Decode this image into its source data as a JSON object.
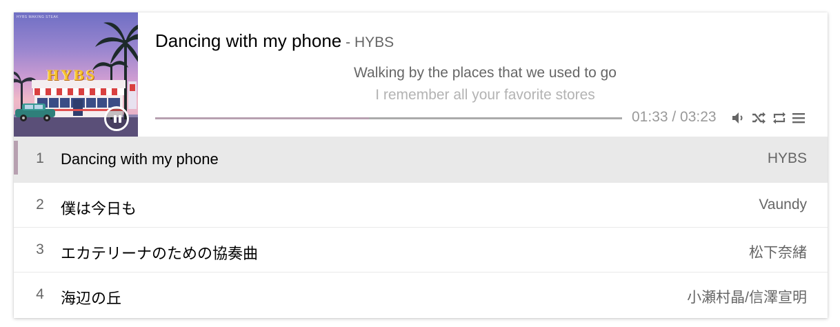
{
  "player": {
    "title": "Dancing with my phone",
    "separator": " - ",
    "artist": "HYBS",
    "cover_tag": "HYBS MAKING STEAK",
    "cover_logo": "HYBS",
    "state": "playing",
    "lyrics": {
      "current": "Walking by the places that we used to go",
      "next": "I remember all your favorite stores"
    },
    "time": "01:33 / 03:23",
    "progress_fraction": 0.458,
    "loaded_fraction": 1.0,
    "icons": [
      "volume-icon",
      "shuffle-icon",
      "repeat-icon",
      "menu-icon"
    ],
    "accent_color": "#b7a0b0"
  },
  "playlist": [
    {
      "index": "1",
      "title": "Dancing with my phone",
      "artist": "HYBS",
      "active": true
    },
    {
      "index": "2",
      "title": "僕は今日も",
      "artist": "Vaundy",
      "active": false
    },
    {
      "index": "3",
      "title": "エカテリーナのための協奏曲",
      "artist": "松下奈緒",
      "active": false
    },
    {
      "index": "4",
      "title": "海辺の丘",
      "artist": "小瀬村晶/信澤宣明",
      "active": false
    }
  ]
}
